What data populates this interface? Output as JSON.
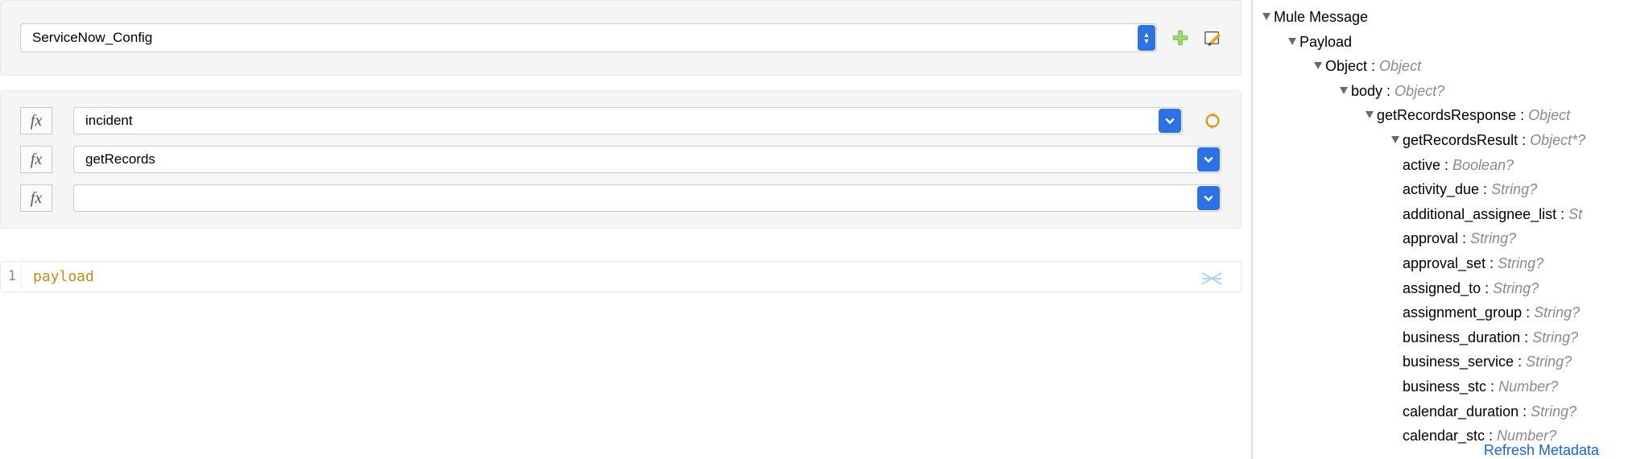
{
  "config": {
    "value": "ServiceNow_Config"
  },
  "params": {
    "fx_label": "fx",
    "row1": {
      "value": "incident"
    },
    "row2": {
      "value": "getRecords"
    },
    "row3": {
      "value": ""
    }
  },
  "editor": {
    "line_number": "1",
    "content": "payload"
  },
  "tree": {
    "root": {
      "label": "Mule Message"
    },
    "payload": {
      "label": "Payload"
    },
    "object": {
      "label": "Object",
      "type": "Object"
    },
    "body": {
      "label": "body",
      "type": "Object?"
    },
    "getRecordsResponse": {
      "label": "getRecordsResponse",
      "type": "Object"
    },
    "getRecordsResult": {
      "label": "getRecordsResult",
      "type": "Object*?"
    },
    "fields": [
      {
        "label": "active",
        "type": "Boolean?"
      },
      {
        "label": "activity_due",
        "type": "String?"
      },
      {
        "label": "additional_assignee_list",
        "type": "St"
      },
      {
        "label": "approval",
        "type": "String?"
      },
      {
        "label": "approval_set",
        "type": "String?"
      },
      {
        "label": "assigned_to",
        "type": "String?"
      },
      {
        "label": "assignment_group",
        "type": "String?"
      },
      {
        "label": "business_duration",
        "type": "String?"
      },
      {
        "label": "business_service",
        "type": "String?"
      },
      {
        "label": "business_stc",
        "type": "Number?"
      },
      {
        "label": "calendar_duration",
        "type": "String?"
      },
      {
        "label": "calendar_stc",
        "type": "Number?"
      }
    ]
  },
  "footer": {
    "refresh": "Refresh Metadata"
  }
}
